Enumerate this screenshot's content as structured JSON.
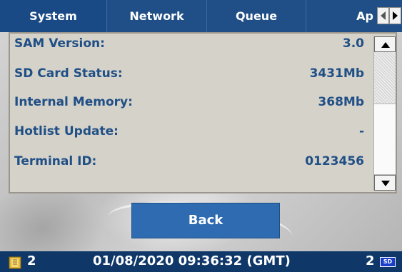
{
  "tabs": [
    {
      "label": "System",
      "active": true
    },
    {
      "label": "Network",
      "active": false
    },
    {
      "label": "Queue",
      "active": false
    },
    {
      "label": "Ap",
      "active": false
    }
  ],
  "tab_nav": {
    "left_icon": "chevron-left-icon",
    "right_icon": "chevron-right-icon"
  },
  "info": {
    "rows": [
      {
        "label": "SAM Version:",
        "value": "3.0"
      },
      {
        "label": "SD Card Status:",
        "value": "3431Mb"
      },
      {
        "label": "Internal Memory:",
        "value": "368Mb"
      },
      {
        "label": "Hotlist Update:",
        "value": "-"
      },
      {
        "label": "Terminal ID:",
        "value": "0123456"
      }
    ]
  },
  "back_button": {
    "label": "Back"
  },
  "status": {
    "sim_icon": "sim-card-icon",
    "left_count": "2",
    "datetime": "01/08/2020 09:36:32 (GMT)",
    "right_count": "2",
    "sd_icon": "sd-card-icon",
    "sd_icon_text": "SD"
  },
  "colors": {
    "accent": "#1f4f86",
    "button": "#2e6bb0",
    "status_bar": "#0f3768",
    "panel": "#d5d2c9"
  }
}
